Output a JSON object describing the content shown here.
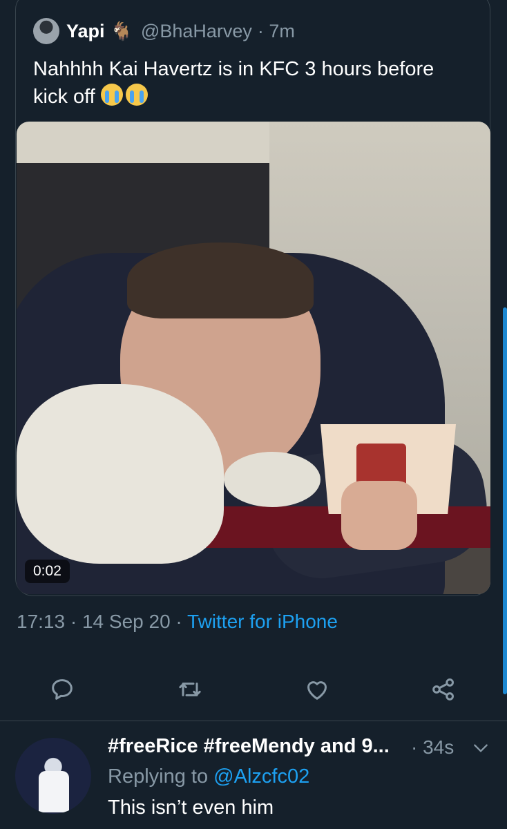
{
  "quoted_tweet": {
    "name": "Yapi",
    "name_emoji": "🐐",
    "handle": "@BhaHarvey",
    "time": "· 7m",
    "text": "Nahhhh Kai Havertz is in KFC 3 hours before kick off",
    "emojis": [
      "loudly-crying-face-emoji",
      "loudly-crying-face-emoji"
    ],
    "video_duration": "0:02"
  },
  "tweet_meta": {
    "time": "17:13",
    "separator1": "·",
    "date": "14 Sep 20",
    "separator2": "·",
    "source": "Twitter for iPhone"
  },
  "actions": [
    "reply-icon",
    "retweet-icon",
    "like-icon",
    "share-icon"
  ],
  "reply": {
    "name": "#freeRice #freeMendy and 9...",
    "time": "· 34s",
    "replying_label": "Replying to",
    "replying_to": "@Alzcfc02",
    "text": "This isn’t even him"
  },
  "colors": {
    "background": "#15202b",
    "border": "#38444d",
    "secondary_text": "#8899a6",
    "accent": "#1da1f2"
  }
}
